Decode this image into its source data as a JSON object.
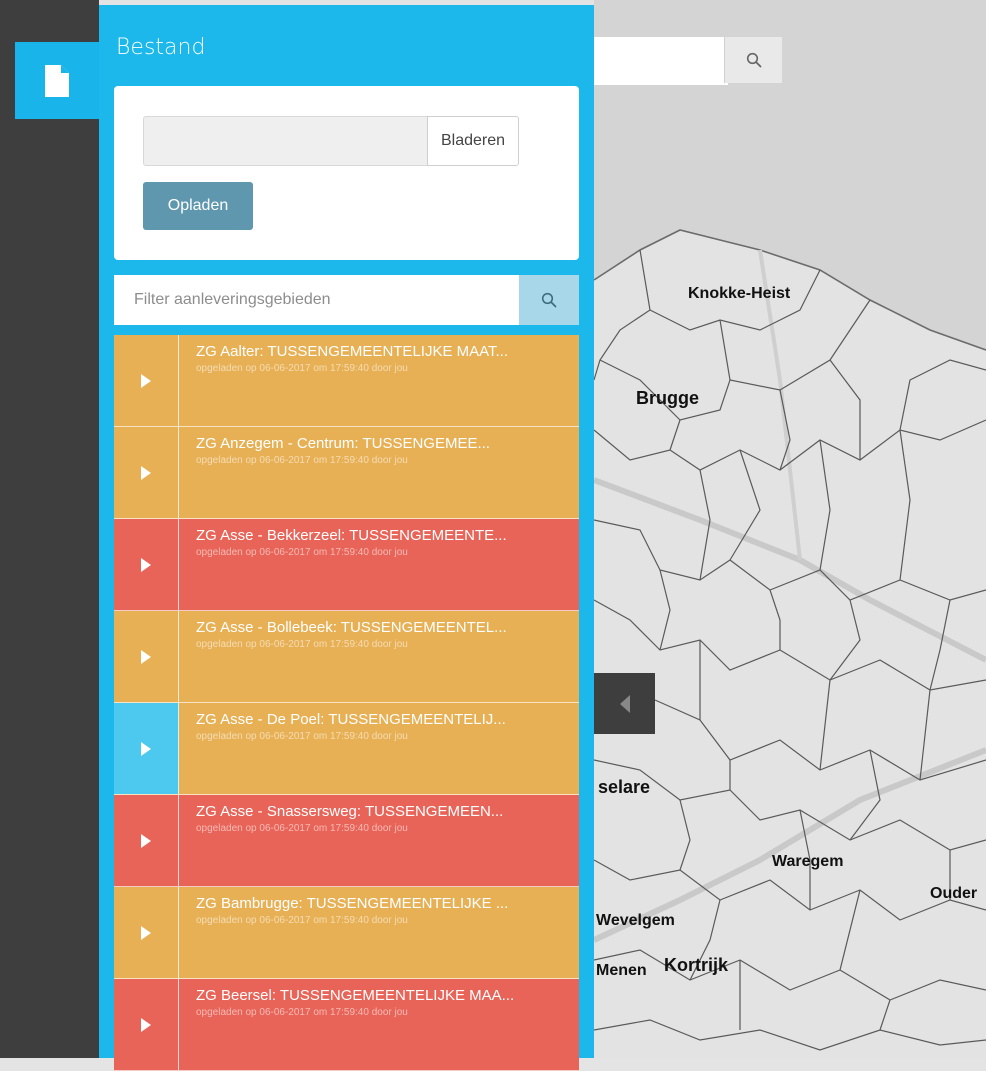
{
  "colors": {
    "accent": "#18b4ea",
    "orange": "#e8b055",
    "red": "#e96458",
    "active_toggle": "#4dc8ee",
    "rail": "#3e3e3e",
    "upload_button": "#5f97ae"
  },
  "sidebar": {
    "file_tab_icon": "document-icon",
    "collapse_icon": "caret-left-icon"
  },
  "panel": {
    "title": "Bestand",
    "upload": {
      "browse_label": "Bladeren",
      "upload_label": "Opladen",
      "file_value": ""
    },
    "filter": {
      "placeholder": "Filter aanleveringsgebieden",
      "value": "",
      "search_icon": "search-icon"
    },
    "items": [
      {
        "title": "ZG Aalter: TUSSENGEMEENTELIJKE MAAT...",
        "meta": "opgeladen op 06-06-2017 om 17:59:40 door jou",
        "status": "orange",
        "active": false
      },
      {
        "title": "ZG Anzegem - Centrum: TUSSENGEMEE...",
        "meta": "opgeladen op 06-06-2017 om 17:59:40 door jou",
        "status": "orange",
        "active": false
      },
      {
        "title": "ZG Asse - Bekkerzeel: TUSSENGEMEENTE...",
        "meta": "opgeladen op 06-06-2017 om 17:59:40 door jou",
        "status": "red",
        "active": false
      },
      {
        "title": "ZG Asse - Bollebeek: TUSSENGEMEENTEL...",
        "meta": "opgeladen op 06-06-2017 om 17:59:40 door jou",
        "status": "orange",
        "active": false
      },
      {
        "title": "ZG Asse - De Poel: TUSSENGEMEENTELIJ...",
        "meta": "opgeladen op 06-06-2017 om 17:59:40 door jou",
        "status": "orange",
        "active": true
      },
      {
        "title": "ZG Asse - Snassersweg: TUSSENGEMEEN...",
        "meta": "opgeladen op 06-06-2017 om 17:59:40 door jou",
        "status": "red",
        "active": false
      },
      {
        "title": "ZG Bambrugge: TUSSENGEMEENTELIJKE ...",
        "meta": "opgeladen op 06-06-2017 om 17:59:40 door jou",
        "status": "orange",
        "active": false
      },
      {
        "title": "ZG Beersel: TUSSENGEMEENTELIJKE MAA...",
        "meta": "opgeladen op 06-06-2017 om 17:59:40 door jou",
        "status": "red",
        "active": false
      }
    ]
  },
  "map": {
    "search_value": "",
    "search_icon": "search-icon",
    "cities": [
      {
        "name": "Knokke-Heist"
      },
      {
        "name": "Brugge"
      },
      {
        "name": "selare"
      },
      {
        "name": "Waregem"
      },
      {
        "name": "Ouder"
      },
      {
        "name": "Wevelgem"
      },
      {
        "name": "Menen"
      },
      {
        "name": "Kortrijk"
      }
    ]
  }
}
